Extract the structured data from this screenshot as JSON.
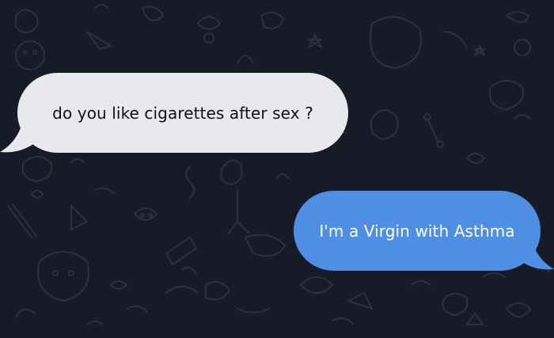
{
  "chat": {
    "messages": [
      {
        "direction": "incoming",
        "text": "do you like cigarettes after sex ?",
        "bubble_color": "#e9e8ec",
        "text_color": "#111111"
      },
      {
        "direction": "outgoing",
        "text": "I'm a Virgin with Asthma",
        "bubble_color": "#4f8fe3",
        "text_color": "#ffffff"
      }
    ],
    "background_color": "#161b27",
    "doodle_color": "#2a3242"
  }
}
